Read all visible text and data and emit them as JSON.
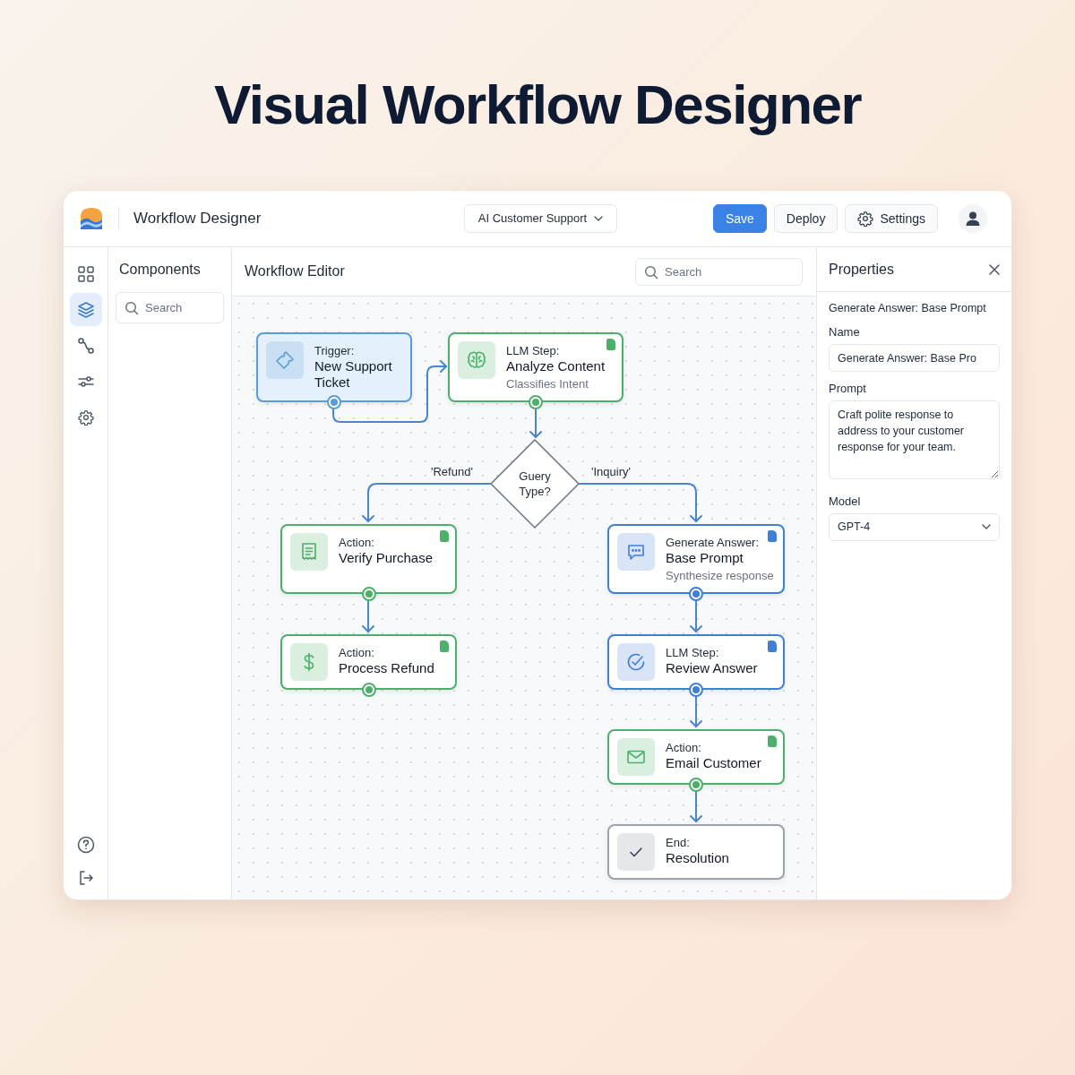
{
  "headline": "Visual Workflow Designer",
  "app": {
    "title": "Workflow Designer",
    "project": "AI Customer Support"
  },
  "buttons": [
    {
      "label": "Save",
      "kind": "primary"
    },
    {
      "label": "Deploy",
      "kind": "plain"
    },
    {
      "label": "Settings",
      "kind": "settings"
    }
  ],
  "rail_items": [
    {
      "selected": false
    },
    {
      "selected": true
    },
    {
      "selected": false
    },
    {
      "selected": false
    },
    {
      "selected": false
    }
  ],
  "components": {
    "title": "Components",
    "search": {
      "placeholder": "Search"
    }
  },
  "editor": {
    "title": "Workflow Editor",
    "search": {
      "placeholder": "Search"
    }
  },
  "nodes": [
    {
      "kind": "trigger",
      "type_label": "Trigger:",
      "title": "New Support Ticket",
      "color": "#5b9bd8",
      "doc_badge": false,
      "port": true
    },
    {
      "kind": "step",
      "type_label": "LLM Step:",
      "title": "Analyze Content",
      "subtitle": "Classifies Intent",
      "color": "#4caf6a",
      "doc_badge": true,
      "port": true
    },
    {
      "kind": "step",
      "type_label": "Action:",
      "title": "Verify Purchase",
      "color": "#4caf6a",
      "doc_badge": true,
      "port": true
    },
    {
      "kind": "step",
      "type_label": "Action:",
      "title": "Process Refund",
      "color": "#4caf6a",
      "doc_badge": true,
      "port": true
    },
    {
      "kind": "step",
      "type_label": "Generate Answer:",
      "title": "Base Prompt",
      "subtitle": "Synthesize response",
      "color": "#3f7fd6",
      "doc_badge": true,
      "port": true
    },
    {
      "kind": "step",
      "type_label": "LLM Step:",
      "title": "Review Answer",
      "color": "#3f7fd6",
      "doc_badge": true,
      "port": true
    },
    {
      "kind": "step",
      "type_label": "Action:",
      "title": "Email Customer",
      "color": "#4caf6a",
      "doc_badge": true,
      "port": true
    },
    {
      "kind": "end",
      "type_label": "End:",
      "title": "Resolution",
      "color": "#9ca3af",
      "doc_badge": false,
      "port": false
    }
  ],
  "decision": {
    "label": "Guery Type?",
    "branches": [
      "'Refund'",
      "'Inquiry'"
    ]
  },
  "properties": {
    "title": "Properties",
    "selected_node": "Generate Answer: Base Prompt",
    "name_label": "Name",
    "name_value": "Generate Answer: Base Pro",
    "prompt_label": "Prompt",
    "prompt_value": "Craft polite response to address to your customer response for your team.",
    "model_label": "Model",
    "model_value": "GPT-4"
  }
}
